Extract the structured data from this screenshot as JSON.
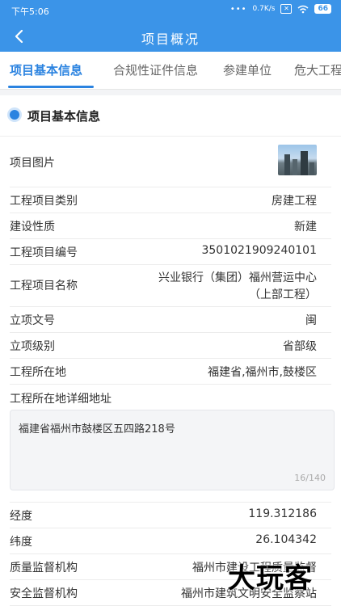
{
  "status": {
    "time": "下午5:06",
    "speed": "0.7K/s",
    "battery": "66"
  },
  "nav": {
    "title": "项目概况"
  },
  "tabs": [
    "项目基本信息",
    "合规性证件信息",
    "参建单位",
    "危大工程"
  ],
  "section": {
    "title": "项目基本信息"
  },
  "rows": {
    "picture_label": "项目图片",
    "category": {
      "label": "工程项目类别",
      "value": "房建工程"
    },
    "nature": {
      "label": "建设性质",
      "value": "新建"
    },
    "code": {
      "label": "工程项目编号",
      "value": "3501021909240101"
    },
    "name": {
      "label": "工程项目名称",
      "value_line1": "兴业银行（集团）福州营运中心",
      "value_line2": "（上部工程）"
    },
    "approval_no": {
      "label": "立项文号",
      "value": "闽"
    },
    "level": {
      "label": "立项级别",
      "value": "省部级"
    },
    "location": {
      "label": "工程所在地",
      "value": "福建省,福州市,鼓楼区"
    },
    "address": {
      "label": "工程所在地详细地址",
      "value": "福建省福州市鼓楼区五四路218号",
      "counter": "16/140"
    },
    "longitude": {
      "label": "经度",
      "value": "119.312186"
    },
    "latitude": {
      "label": "纬度",
      "value": "26.104342"
    },
    "quality": {
      "label": "质量监督机构",
      "value": "福州市建设工程质量监督"
    },
    "safety": {
      "label": "安全监督机构",
      "value": "福州市建筑文明安全监察站"
    }
  },
  "watermark": "大玩客"
}
